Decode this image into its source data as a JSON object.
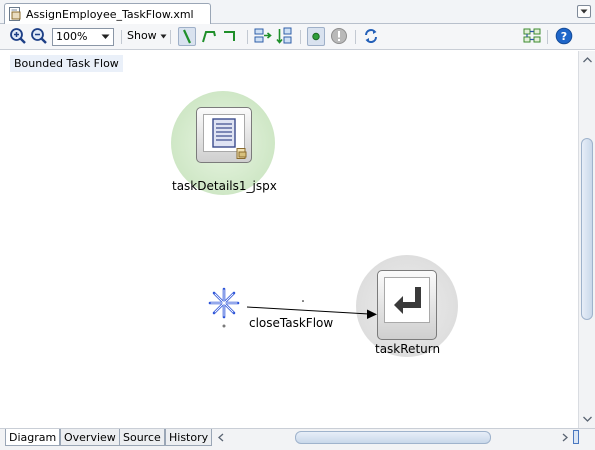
{
  "editor_tab": {
    "title": "AssignEmployee_TaskFlow.xml"
  },
  "toolbar": {
    "zoom_value": "100%",
    "show_label": "Show"
  },
  "canvas": {
    "diagram_label": "Bounded Task Flow",
    "nodes": [
      {
        "name": "taskDetails1_jspx",
        "type": "view activity"
      },
      {
        "name": "taskReturn",
        "type": "task flow return"
      }
    ],
    "control_flow": {
      "label": "closeTaskFlow"
    }
  },
  "bottom_tabs": [
    {
      "label": "Diagram",
      "active": true
    },
    {
      "label": "Overview",
      "active": false
    },
    {
      "label": "Source",
      "active": false
    },
    {
      "label": "History",
      "active": false
    }
  ],
  "colors": {
    "view_halo": "#cfe7c6",
    "return_halo": "#dedede",
    "wildcard": "#2a52d8",
    "help": "#1f66c9",
    "run_dot": "#2f9e3a"
  },
  "icons": {
    "tab_file": "xml-file-icon",
    "zoom_in": "zoom-in-icon",
    "zoom_out": "zoom-out-icon",
    "help": "help-icon"
  }
}
